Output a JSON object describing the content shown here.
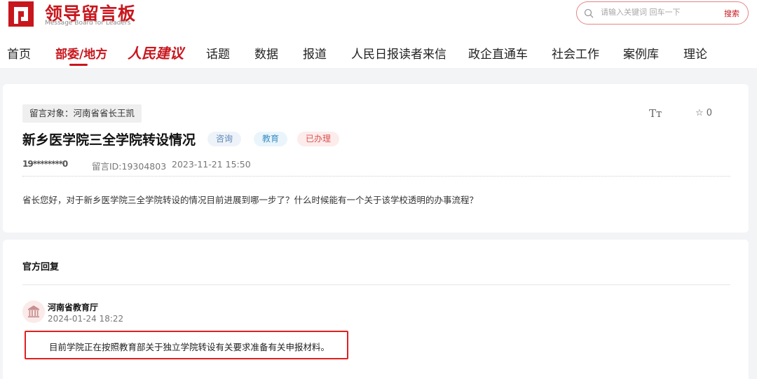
{
  "brand": {
    "name": "领导留言板",
    "subtitle": "Message Board for Leaders",
    "color": "#c8161d"
  },
  "search": {
    "placeholder": "请输入关键词 回车一下",
    "button_label": "搜索"
  },
  "nav": {
    "items": [
      {
        "label": "首页"
      },
      {
        "label": "部委/地方",
        "active": true
      },
      {
        "label": "人民建议"
      },
      {
        "label": "话题"
      },
      {
        "label": "数据"
      },
      {
        "label": "报道"
      },
      {
        "label": "人民日报读者来信"
      },
      {
        "label": "政企直通车"
      },
      {
        "label": "社会工作"
      },
      {
        "label": "案例库"
      },
      {
        "label": "理论"
      }
    ]
  },
  "message": {
    "target": "留言对象：河南省省长王凯",
    "title": "新乡医学院三全学院转设情况",
    "tags": [
      "咨询",
      "教育",
      "已办理"
    ],
    "user": "19********0",
    "id": "留言ID:19304803",
    "time": "2023-11-21 15:50",
    "favorite_count": "0",
    "font_size_icon": "text-size-icon",
    "content": "省长您好，对于新乡医学院三全学院转设的情况目前进展到哪一步了？什么时候能有一个关于该学校透明的办事流程？"
  },
  "reply": {
    "heading": "官方回复",
    "org_name": "河南省教育厅",
    "org_icon": "government-building-icon",
    "time": "2024-01-24 18:22",
    "content": "目前学院正在按照教育部关于独立学院转设有关要求准备有关申报材料。"
  }
}
